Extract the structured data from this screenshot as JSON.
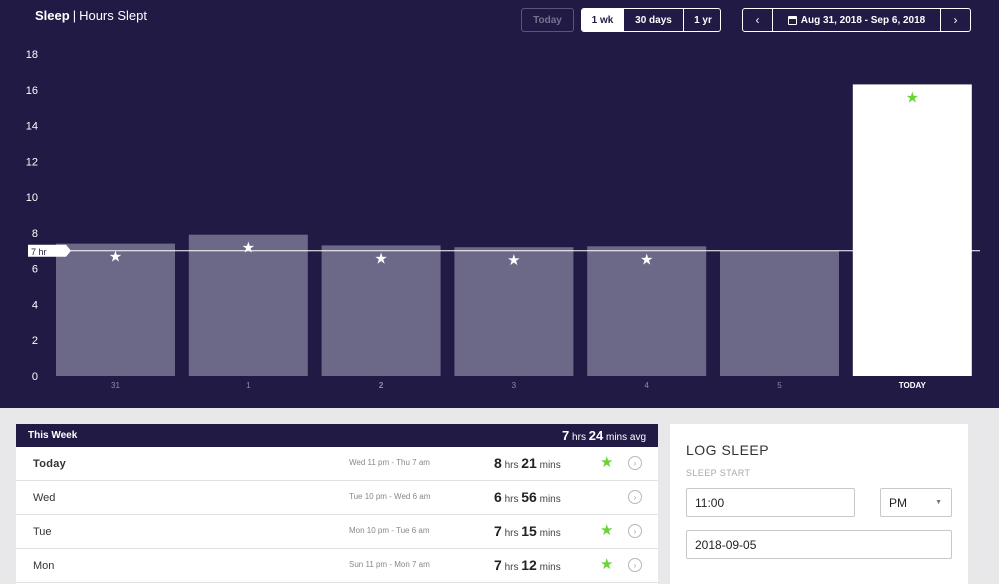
{
  "header": {
    "title": "Sleep",
    "separator": "|",
    "subtitle": "Hours Slept"
  },
  "controls": {
    "today_label": "Today",
    "ranges": [
      {
        "label": "1 wk",
        "active": true
      },
      {
        "label": "30 days",
        "active": false
      },
      {
        "label": "1 yr",
        "active": false
      }
    ],
    "date_range": "Aug 31, 2018 - Sep 6, 2018",
    "prev_icon": "chevron-left-icon",
    "next_icon": "chevron-right-icon",
    "calendar_icon": "calendar-icon"
  },
  "chart_data": {
    "type": "bar",
    "categories": [
      "31",
      "1",
      "2",
      "3",
      "4",
      "5",
      "TODAY"
    ],
    "values": [
      7.4,
      7.9,
      7.3,
      7.2,
      7.25,
      7.0,
      16.3
    ],
    "goal_met": [
      true,
      true,
      true,
      true,
      true,
      false,
      true
    ],
    "ylim": [
      0,
      18
    ],
    "yticks": [
      0,
      2,
      4,
      6,
      8,
      10,
      12,
      14,
      16,
      18
    ],
    "goal_line": {
      "value": 7,
      "label": "7 hr"
    },
    "highlight_category": "TODAY",
    "colors": {
      "background": "#211a45",
      "bar": "#6c6888",
      "highlight_bar": "#ffffff",
      "star": "#ffffff",
      "highlight_star": "#6bd238",
      "goal_line": "#ffffff"
    }
  },
  "week": {
    "title": "This Week",
    "avg_hrs": "7",
    "avg_hrs_unit": "hrs",
    "avg_mins": "24",
    "avg_mins_unit": "mins avg",
    "rows": [
      {
        "day": "Today",
        "span": "Wed 11 pm - Thu 7 am",
        "hrs": "8",
        "mins": "21",
        "star": true
      },
      {
        "day": "Wed",
        "span": "Tue 10 pm - Wed 6 am",
        "hrs": "6",
        "mins": "56",
        "star": false
      },
      {
        "day": "Tue",
        "span": "Mon 10 pm - Tue 6 am",
        "hrs": "7",
        "mins": "15",
        "star": true
      },
      {
        "day": "Mon",
        "span": "Sun 11 pm - Mon 7 am",
        "hrs": "7",
        "mins": "12",
        "star": true
      }
    ],
    "hrs_unit": "hrs",
    "mins_unit": "mins",
    "star_glyph": "★",
    "chevron_glyph": "›"
  },
  "log": {
    "title": "LOG SLEEP",
    "start_label": "SLEEP START",
    "time_value": "11:00",
    "ampm_value": "PM",
    "date_value": "2018-09-05"
  }
}
